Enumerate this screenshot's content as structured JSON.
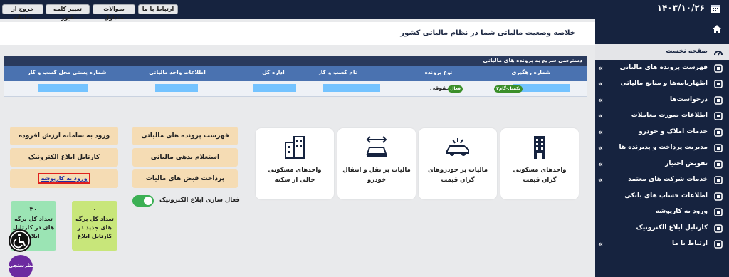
{
  "topbar": {
    "buttons": [
      "ارتباط با ما",
      "سوالات متداول",
      "تغییر کلمه عبور",
      "خروج از سامانه"
    ],
    "date": "۱۴۰۳/۱۰/۲۶"
  },
  "sidebar": {
    "items": [
      {
        "label": "صفحه نخست",
        "icon": "speedometer-icon",
        "active": true,
        "chevron": false
      },
      {
        "label": "فهرست پرونده های مالیاتی",
        "icon": "files-icon",
        "active": false,
        "chevron": true
      },
      {
        "label": "اظهارنامه‌ها و منابع مالیاتی",
        "icon": "document-icon",
        "active": false,
        "chevron": true
      },
      {
        "label": "درخواست‌ها",
        "icon": "request-icon",
        "active": false,
        "chevron": true
      },
      {
        "label": "اطلاعات صورت معاملات",
        "icon": "transactions-icon",
        "active": false,
        "chevron": true
      },
      {
        "label": "خدمات املاک و خودرو",
        "icon": "car-icon",
        "active": false,
        "chevron": true
      },
      {
        "label": "مدیریت پرداخت و پذیرنده ها",
        "icon": "card-icon",
        "active": false,
        "chevron": true
      },
      {
        "label": "تفویض اختیار",
        "icon": "delegate-icon",
        "active": false,
        "chevron": true
      },
      {
        "label": "خدمات شرکت های معتمد",
        "icon": "trusted-icon",
        "active": false,
        "chevron": true
      },
      {
        "label": "اطلاعات حساب های بانکی",
        "icon": "bank-icon",
        "active": false,
        "chevron": false
      },
      {
        "label": "ورود به کارپوشه",
        "icon": "folder-icon",
        "active": false,
        "chevron": false
      },
      {
        "label": "کارتابل ابلاغ الکترونیک",
        "icon": "inbox-icon",
        "active": false,
        "chevron": false
      },
      {
        "label": "ارتباط با ما",
        "icon": "mail-icon",
        "active": false,
        "chevron": true
      }
    ]
  },
  "main": {
    "title": "خلاصه وضعیت مالیاتی شما در نظام مالیاتی کشور",
    "quick_access": {
      "header": "دسترسی سریع به پرونده های مالیاتی",
      "columns": [
        "شماره رهگیری",
        "نوع پرونده",
        "نام کسب و کار",
        "اداره کل",
        "اطلاعات واحد مالیاتی",
        "شماره پستی محل کسب و کار"
      ],
      "row": {
        "badge": "تکمیل-گام۲",
        "type": "حقوقی",
        "type_badge": "فعال"
      }
    },
    "services": [
      {
        "label": "واحدهای مسکونی گران قیمت",
        "icon": "building-icon"
      },
      {
        "label": "مالیات بر خودروهای گران قیمت",
        "icon": "luxury-car-icon"
      },
      {
        "label": "مالیات بر نقل و انتقال خودرو",
        "icon": "car-transfer-icon"
      },
      {
        "label": "واحدهای مسکونی خالی از سکنه",
        "icon": "empty-building-icon"
      }
    ],
    "middle_buttons": [
      "فهرست پرونده های مالیاتی",
      "استعلام بدهی مالیاتی",
      "پرداخت قبض های مالیات"
    ],
    "left_buttons": [
      "ورود به سامانه ارزش افزوده",
      "کارتابل ابلاغ الکترونیک",
      "ورود به کارپوشه"
    ],
    "toggle_label": "فعال سازی ابلاغ الکترونیک",
    "counts": [
      {
        "num": "۰",
        "caption": "تعداد کل برگه های جدید در کارتابل ابلاغ",
        "color": "#c8e67a"
      },
      {
        "num": "۳۰",
        "caption": "تعداد کل برگه های در کارتابل ابلاغ",
        "color": "#9be4b4"
      }
    ],
    "survey_label": "نظرسنجی"
  },
  "colors": {
    "navy": "#16233f",
    "table_head": "#4a72b0",
    "orange": "#f5dcb4",
    "green": "#3cb054"
  }
}
